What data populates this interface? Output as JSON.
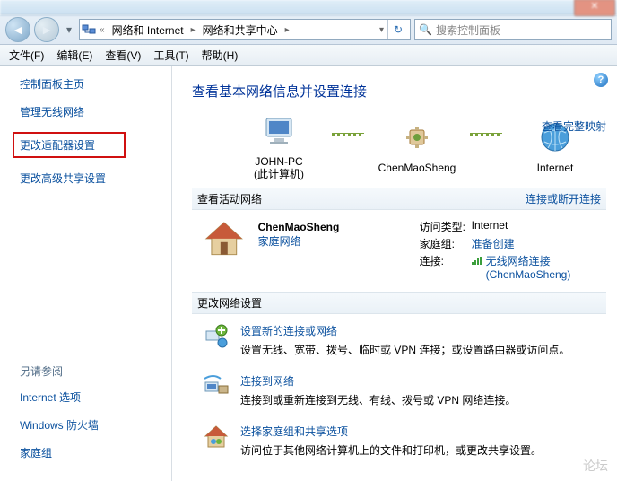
{
  "window": {
    "close": "✕"
  },
  "nav": {
    "back": "‹",
    "forward": "›"
  },
  "path": {
    "root": "«",
    "crumb1": "网络和 Internet",
    "crumb2": "网络和共享中心"
  },
  "search": {
    "placeholder": "搜索控制面板"
  },
  "menu": {
    "file": "文件(F)",
    "edit": "编辑(E)",
    "view": "查看(V)",
    "tools": "工具(T)",
    "help": "帮助(H)"
  },
  "sidebar": {
    "home": "控制面板主页",
    "wireless": "管理无线网络",
    "adapter": "更改适配器设置",
    "advanced": "更改高级共享设置",
    "seealso_head": "另请参阅",
    "seealso": {
      "inetopts": "Internet 选项",
      "firewall": "Windows 防火墙",
      "homegroup": "家庭组"
    }
  },
  "heading": "查看基本网络信息并设置连接",
  "map": {
    "viewmap": "查看完整映射",
    "node1": "JOHN-PC",
    "node1_sub": "(此计算机)",
    "node2": "ChenMaoSheng",
    "node3": "Internet"
  },
  "section_active": "查看活动网络",
  "active_right": "连接或断开连接",
  "active": {
    "name": "ChenMaoSheng",
    "type": "家庭网络",
    "r1k": "访问类型:",
    "r1v": "Internet",
    "r2k": "家庭组:",
    "r2v": "准备创建",
    "r3k": "连接:",
    "r3v": "无线网络连接",
    "r3v2": "(ChenMaoSheng)"
  },
  "section_change": "更改网络设置",
  "chg": {
    "i1t": "设置新的连接或网络",
    "i1d": "设置无线、宽带、拨号、临时或 VPN 连接；或设置路由器或访问点。",
    "i2t": "连接到网络",
    "i2d": "连接到或重新连接到无线、有线、拨号或 VPN 网络连接。",
    "i3t": "选择家庭组和共享选项",
    "i3d": "访问位于其他网络计算机上的文件和打印机，或更改共享设置。"
  },
  "watermark": "论坛"
}
